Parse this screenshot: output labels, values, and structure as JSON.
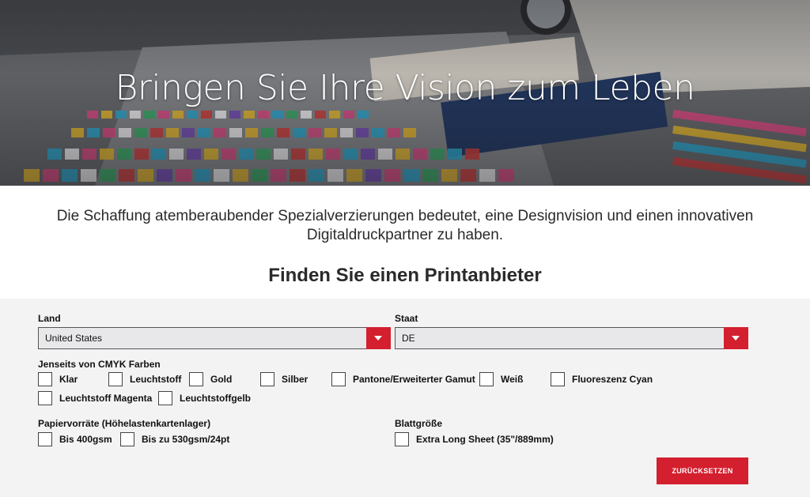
{
  "hero": {
    "title": "Bringen Sie Ihre Vision zum Leben"
  },
  "intro": {
    "text": "Die Schaffung atemberaubender Spezialverzierungen bedeutet, eine Designvision und einen innovativen Digitaldruckpartner zu haben."
  },
  "finder": {
    "title": "Finden Sie einen Printanbieter",
    "country": {
      "label": "Land",
      "value": "United States"
    },
    "state": {
      "label": "Staat",
      "value": "DE"
    },
    "cmyk": {
      "label": "Jenseits von CMYK Farben",
      "options": [
        "Klar",
        "Leuchtstoff",
        "Gold",
        "Silber",
        "Pantone/Erweiterter Gamut",
        "Weiß",
        "Fluoreszenz Cyan",
        "Leuchtstoff Magenta",
        "Leuchtstoffgelb"
      ]
    },
    "paper": {
      "label": "Papiervorräte (Höhelastenkartenlager)",
      "options": [
        "Bis 400gsm",
        "Bis zu 530gsm/24pt"
      ]
    },
    "sheet": {
      "label": "Blattgröße",
      "options": [
        "Extra Long Sheet (35\"/889mm)"
      ]
    },
    "reset_label": "ZURÜCKSETZEN"
  },
  "colors": {
    "accent": "#d31f2e",
    "page_bg": "#f3f3f3"
  }
}
